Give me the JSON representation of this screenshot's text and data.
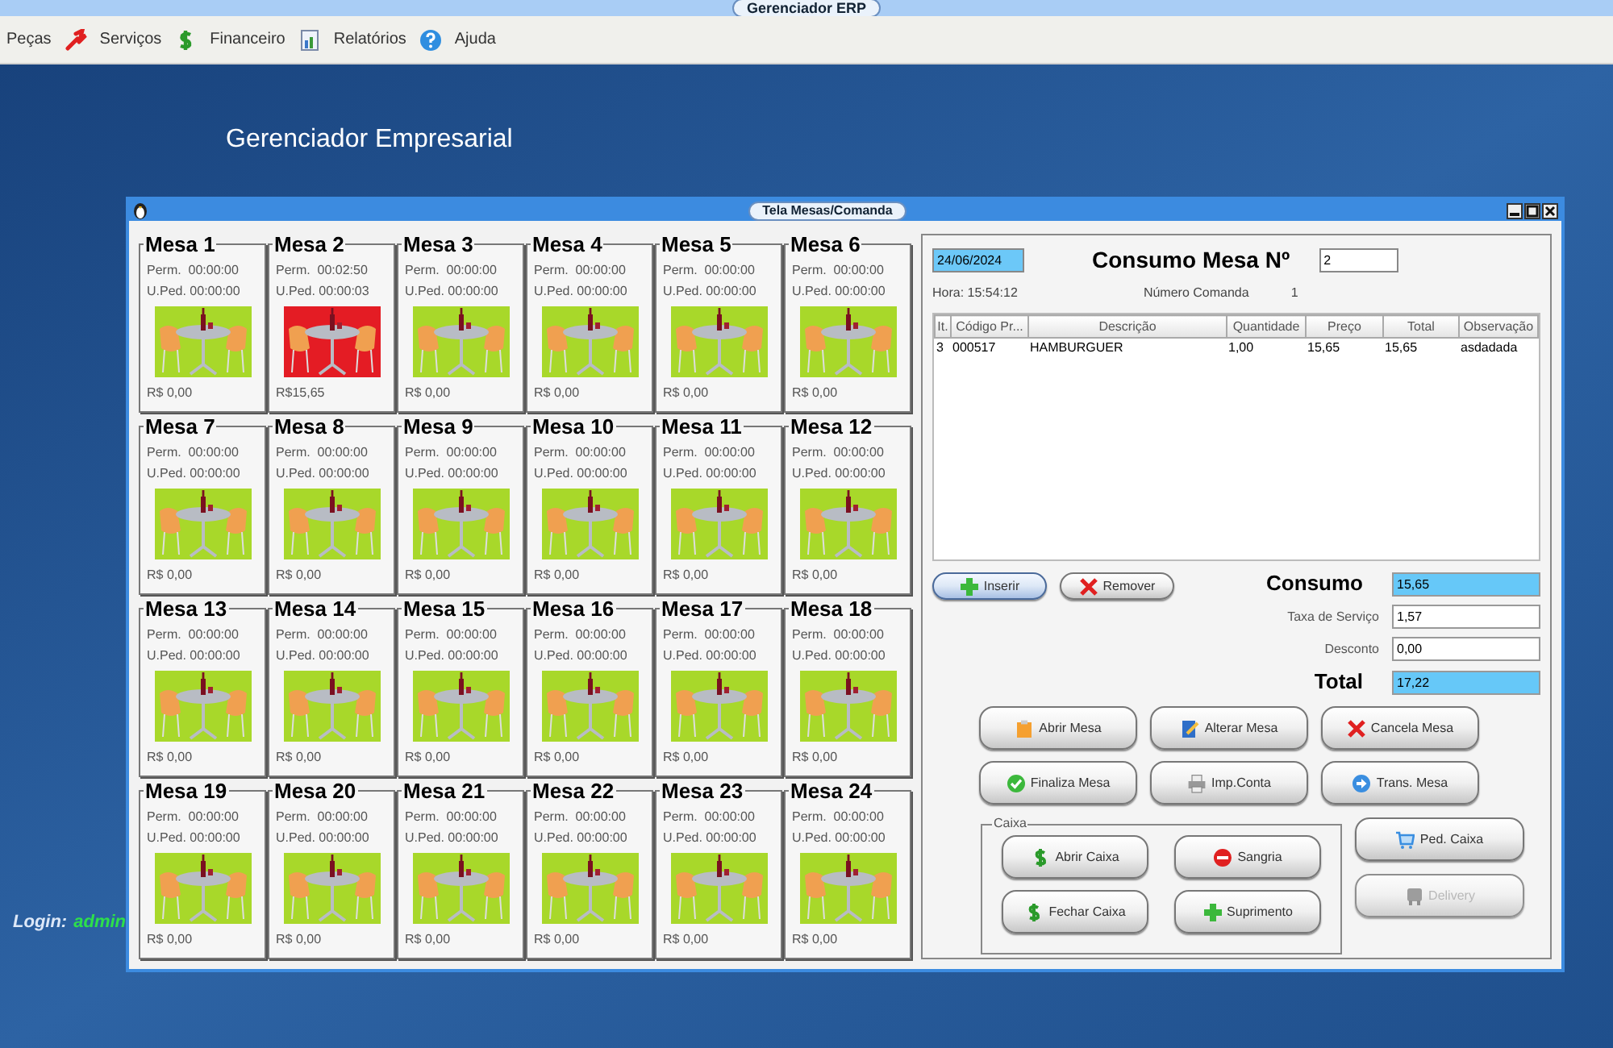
{
  "app_title": "Gerenciador ERP",
  "menu": [
    {
      "label": "Peças"
    },
    {
      "label": "Serviços"
    },
    {
      "label": "Financeiro"
    },
    {
      "label": "Relatórios"
    },
    {
      "label": "Ajuda"
    }
  ],
  "desktop_title": "Gerenciador Empresarial",
  "login": {
    "label": "Login:",
    "user": "admin"
  },
  "window": {
    "title": "Tela Mesas/Comanda"
  },
  "tables": [
    {
      "name": "Mesa 1",
      "perm": "Perm.  00:00:00",
      "uped": "U.Ped. 00:00:00",
      "amount": "R$ 0,00",
      "occupied": false
    },
    {
      "name": "Mesa 2",
      "perm": "Perm.  00:02:50",
      "uped": "U.Ped. 00:00:03",
      "amount": "R$15,65",
      "occupied": true
    },
    {
      "name": "Mesa 3",
      "perm": "Perm.  00:00:00",
      "uped": "U.Ped. 00:00:00",
      "amount": "R$ 0,00",
      "occupied": false
    },
    {
      "name": "Mesa 4",
      "perm": "Perm.  00:00:00",
      "uped": "U.Ped. 00:00:00",
      "amount": "R$ 0,00",
      "occupied": false
    },
    {
      "name": "Mesa 5",
      "perm": "Perm.  00:00:00",
      "uped": "U.Ped. 00:00:00",
      "amount": "R$ 0,00",
      "occupied": false
    },
    {
      "name": "Mesa 6",
      "perm": "Perm.  00:00:00",
      "uped": "U.Ped. 00:00:00",
      "amount": "R$ 0,00",
      "occupied": false
    },
    {
      "name": "Mesa 7",
      "perm": "Perm.  00:00:00",
      "uped": "U.Ped. 00:00:00",
      "amount": "R$ 0,00",
      "occupied": false
    },
    {
      "name": "Mesa 8",
      "perm": "Perm.  00:00:00",
      "uped": "U.Ped. 00:00:00",
      "amount": "R$ 0,00",
      "occupied": false
    },
    {
      "name": "Mesa 9",
      "perm": "Perm.  00:00:00",
      "uped": "U.Ped. 00:00:00",
      "amount": "R$ 0,00",
      "occupied": false
    },
    {
      "name": "Mesa 10",
      "perm": "Perm.  00:00:00",
      "uped": "U.Ped. 00:00:00",
      "amount": "R$ 0,00",
      "occupied": false
    },
    {
      "name": "Mesa 11",
      "perm": "Perm.  00:00:00",
      "uped": "U.Ped. 00:00:00",
      "amount": "R$ 0,00",
      "occupied": false
    },
    {
      "name": "Mesa 12",
      "perm": "Perm.  00:00:00",
      "uped": "U.Ped. 00:00:00",
      "amount": "R$ 0,00",
      "occupied": false
    },
    {
      "name": "Mesa 13",
      "perm": "Perm.  00:00:00",
      "uped": "U.Ped. 00:00:00",
      "amount": "R$ 0,00",
      "occupied": false
    },
    {
      "name": "Mesa 14",
      "perm": "Perm.  00:00:00",
      "uped": "U.Ped. 00:00:00",
      "amount": "R$ 0,00",
      "occupied": false
    },
    {
      "name": "Mesa 15",
      "perm": "Perm.  00:00:00",
      "uped": "U.Ped. 00:00:00",
      "amount": "R$ 0,00",
      "occupied": false
    },
    {
      "name": "Mesa 16",
      "perm": "Perm.  00:00:00",
      "uped": "U.Ped. 00:00:00",
      "amount": "R$ 0,00",
      "occupied": false
    },
    {
      "name": "Mesa 17",
      "perm": "Perm.  00:00:00",
      "uped": "U.Ped. 00:00:00",
      "amount": "R$ 0,00",
      "occupied": false
    },
    {
      "name": "Mesa 18",
      "perm": "Perm.  00:00:00",
      "uped": "U.Ped. 00:00:00",
      "amount": "R$ 0,00",
      "occupied": false
    },
    {
      "name": "Mesa 19",
      "perm": "Perm.  00:00:00",
      "uped": "U.Ped. 00:00:00",
      "amount": "R$ 0,00",
      "occupied": false
    },
    {
      "name": "Mesa 20",
      "perm": "Perm.  00:00:00",
      "uped": "U.Ped. 00:00:00",
      "amount": "R$ 0,00",
      "occupied": false
    },
    {
      "name": "Mesa 21",
      "perm": "Perm.  00:00:00",
      "uped": "U.Ped. 00:00:00",
      "amount": "R$ 0,00",
      "occupied": false
    },
    {
      "name": "Mesa 22",
      "perm": "Perm.  00:00:00",
      "uped": "U.Ped. 00:00:00",
      "amount": "R$ 0,00",
      "occupied": false
    },
    {
      "name": "Mesa 23",
      "perm": "Perm.  00:00:00",
      "uped": "U.Ped. 00:00:00",
      "amount": "R$ 0,00",
      "occupied": false
    },
    {
      "name": "Mesa 24",
      "perm": "Perm.  00:00:00",
      "uped": "U.Ped. 00:00:00",
      "amount": "R$ 0,00",
      "occupied": false
    }
  ],
  "consumo": {
    "date": "24/06/2024",
    "heading": "Consumo Mesa Nº",
    "table_number": "2",
    "hora": "Hora: 15:54:12",
    "comanda_label": "Número Comanda",
    "comanda": "1",
    "columns": [
      "It.",
      "Código Pr...",
      "Descrição",
      "Quantidade",
      "Preço",
      "Total",
      "Observação"
    ],
    "rows": [
      [
        "3",
        "000517",
        "HAMBURGUER",
        "1,00",
        "15,65",
        "15,65",
        "asdadada"
      ]
    ]
  },
  "item_buttons": [
    {
      "label": "Inserir",
      "selected": true
    },
    {
      "label": "Remover",
      "selected": false
    }
  ],
  "totals": [
    {
      "label": "Consumo",
      "value": "15,65",
      "kind": "major"
    },
    {
      "label": "Taxa de Serviço",
      "value": "1,57",
      "kind": "minor"
    },
    {
      "label": "Desconto",
      "value": "0,00",
      "kind": "minor"
    },
    {
      "label": "Total",
      "value": "17,22",
      "kind": "major"
    }
  ],
  "actions": [
    {
      "label": "Abrir Mesa"
    },
    {
      "label": "Alterar Mesa"
    },
    {
      "label": "Cancela Mesa"
    },
    {
      "label": "Finaliza Mesa"
    },
    {
      "label": "Imp.Conta"
    },
    {
      "label": "Trans. Mesa"
    }
  ],
  "caixa": {
    "title": "Caixa",
    "buttons": [
      {
        "label": "Abrir Caixa"
      },
      {
        "label": "Sangria"
      },
      {
        "label": "Fechar Caixa"
      },
      {
        "label": "Suprimento"
      }
    ]
  },
  "side_buttons": [
    {
      "label": "Ped. Caixa",
      "disabled": false
    },
    {
      "label": "Delivery",
      "disabled": true
    }
  ]
}
